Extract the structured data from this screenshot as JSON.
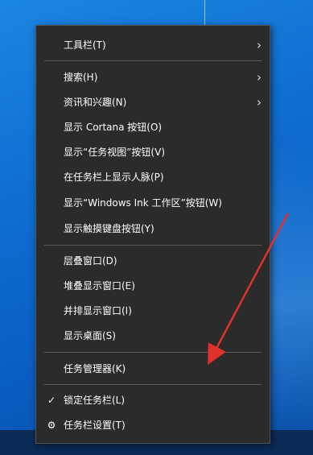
{
  "desktop": {
    "background_color": "#0f6fd1",
    "taskbar_color": "#0c2b57"
  },
  "context_menu": {
    "background_color": "#2b2b2b",
    "items": [
      {
        "label": "工具栏(T)",
        "has_submenu": true
      },
      {
        "label": "搜索(H)",
        "has_submenu": true
      },
      {
        "label": "资讯和兴趣(N)",
        "has_submenu": true
      },
      {
        "label": "显示 Cortana 按钮(O)"
      },
      {
        "label": "显示“任务视图”按钮(V)"
      },
      {
        "label": "在任务栏上显示人脉(P)"
      },
      {
        "label": "显示“Windows Ink 工作区”按钮(W)"
      },
      {
        "label": "显示触摸键盘按钮(Y)"
      },
      {
        "label": "层叠窗口(D)"
      },
      {
        "label": "堆叠显示窗口(E)"
      },
      {
        "label": "并排显示窗口(I)"
      },
      {
        "label": "显示桌面(S)"
      },
      {
        "label": "任务管理器(K)"
      },
      {
        "label": "锁定任务栏(L)",
        "checked": true,
        "lead_glyph": "✓"
      },
      {
        "label": "任务栏设置(T)",
        "icon": "gear-icon",
        "lead_glyph": "⚙"
      }
    ],
    "submenu_glyph": "›"
  },
  "annotation": {
    "arrow_color": "#e0302a",
    "target": "任务管理器(K)"
  }
}
